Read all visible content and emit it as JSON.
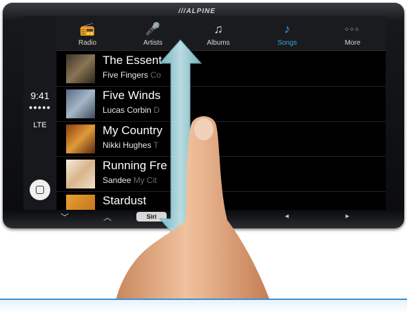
{
  "brand": "///ALPINE",
  "status": {
    "time": "9:41",
    "signal": "●●●●●",
    "network": "LTE"
  },
  "tabs": [
    {
      "label": "Radio",
      "icon": "radio-icon",
      "glyph": "📻",
      "active": false
    },
    {
      "label": "Artists",
      "icon": "artists-icon",
      "glyph": "🎤",
      "active": false
    },
    {
      "label": "Albums",
      "icon": "albums-icon",
      "glyph": "♫",
      "active": false
    },
    {
      "label": "Songs",
      "icon": "songs-icon",
      "glyph": "♪",
      "active": true
    },
    {
      "label": "More",
      "icon": "more-icon",
      "glyph": "○○○",
      "active": false
    }
  ],
  "songs": [
    {
      "title": "The Essent",
      "artist": "Five Fingers",
      "album": "Co",
      "art_color": "#6b5a3a"
    },
    {
      "title": "Five Winds",
      "artist": "Lucas Corbin",
      "album": "D",
      "art_color": "#7d8fa8"
    },
    {
      "title": "My Country",
      "artist": "Nikki Hughes",
      "album": "T",
      "art_color": "#c87a30"
    },
    {
      "title": "Running Fre",
      "artist": "Sandee",
      "album": "My Cit",
      "art_color": "#e0c8b0"
    },
    {
      "title": "Stardust",
      "artist": "",
      "album": "",
      "art_color": "#d08a20"
    }
  ],
  "bottom": {
    "down": "﹀",
    "up": "︿",
    "siri": "Siri",
    "prev": "◄",
    "next": "►"
  },
  "colors": {
    "accent": "#35a7e8",
    "arrow": "#9fd6e0"
  }
}
